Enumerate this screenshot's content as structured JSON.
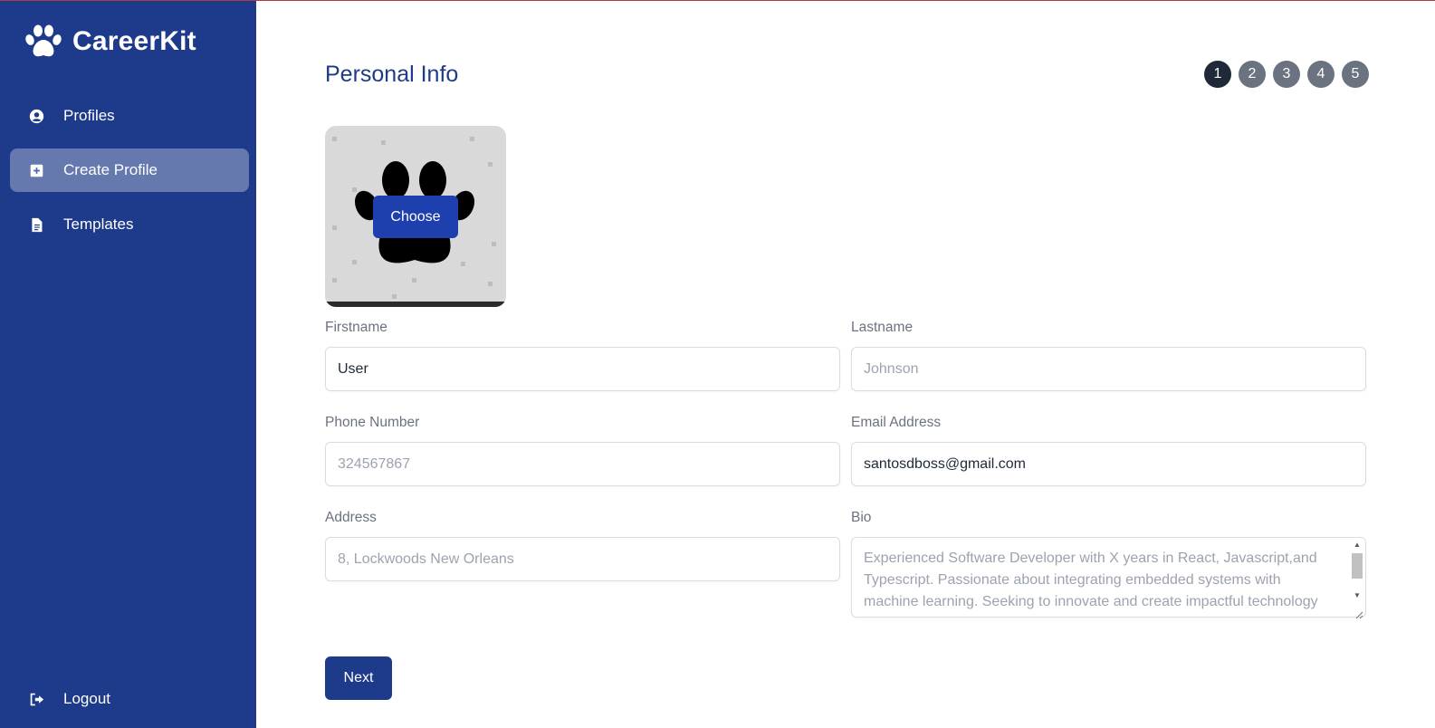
{
  "app": {
    "name": "CareerKit",
    "logo_icon": "paw-icon"
  },
  "sidebar": {
    "items": [
      {
        "label": "Profiles",
        "icon": "user-circle-icon"
      },
      {
        "label": "Create Profile",
        "icon": "plus-square-icon",
        "active": true
      },
      {
        "label": "Templates",
        "icon": "document-icon"
      }
    ],
    "logout": {
      "label": "Logout",
      "icon": "logout-icon"
    }
  },
  "page": {
    "title": "Personal Info"
  },
  "steps": [
    "1",
    "2",
    "3",
    "4",
    "5"
  ],
  "current_step": 1,
  "photo": {
    "choose_label": "Choose"
  },
  "form": {
    "firstname": {
      "label": "Firstname",
      "value": "User",
      "placeholder": ""
    },
    "lastname": {
      "label": "Lastname",
      "value": "",
      "placeholder": "Johnson"
    },
    "phone": {
      "label": "Phone Number",
      "value": "",
      "placeholder": "324567867"
    },
    "email": {
      "label": "Email Address",
      "value": "santosdboss@gmail.com",
      "placeholder": ""
    },
    "address": {
      "label": "Address",
      "value": "",
      "placeholder": "8, Lockwoods New Orleans"
    },
    "bio": {
      "label": "Bio",
      "value": "",
      "placeholder": "Experienced Software Developer with X years in React, Javascript,and Typescript. Passionate about integrating embedded systems with machine learning. Seeking to innovate and create impactful technology"
    }
  },
  "actions": {
    "next_label": "Next"
  },
  "colors": {
    "sidebar": "#1e3a8a",
    "accent": "#1e40af",
    "step_active": "#1f2937",
    "step_inactive": "#6b7280"
  }
}
